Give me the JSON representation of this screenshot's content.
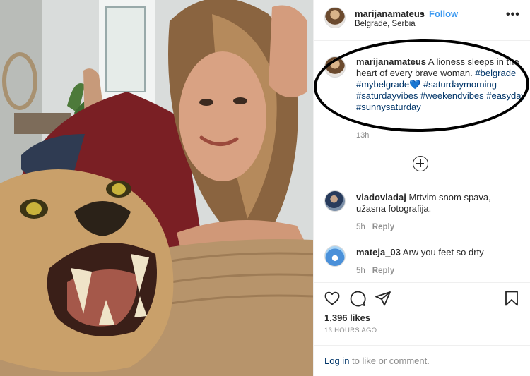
{
  "post": {
    "username": "marijanamateus",
    "separator": "•",
    "follow_label": "Follow",
    "location": "Belgrade, Serbia",
    "more_label": "•••"
  },
  "caption": {
    "username": "marijanamateus",
    "text": "A lioness sleeps in the heart of every brave woman.",
    "hashtags": "#belgrade #mybelgrade💙 #saturdaymorning #saturdayvibes #weekendvibes #easyday #sunnysaturday",
    "time": "13h"
  },
  "comments": [
    {
      "username": "vladovladaj",
      "text": "Mrtvim snom spava, užasna fotografija.",
      "time": "5h",
      "reply_label": "Reply"
    },
    {
      "username": "mateja_03",
      "text": "Arw you feet so drty",
      "time": "5h",
      "reply_label": "Reply"
    }
  ],
  "stats": {
    "likes": "1,396 likes",
    "posted": "13 HOURS AGO"
  },
  "footer": {
    "login_link": "Log in",
    "login_rest": " to like or comment."
  },
  "icons": {
    "like": "heart-icon",
    "comment": "comment-icon",
    "share": "paper-plane-icon",
    "save": "bookmark-icon",
    "more": "more-options-icon",
    "load_more": "plus-circle-icon"
  },
  "colors": {
    "follow": "#3897f0",
    "hashtag": "#003569",
    "muted": "#8e8e8e",
    "annotation_ring": "#000000"
  }
}
